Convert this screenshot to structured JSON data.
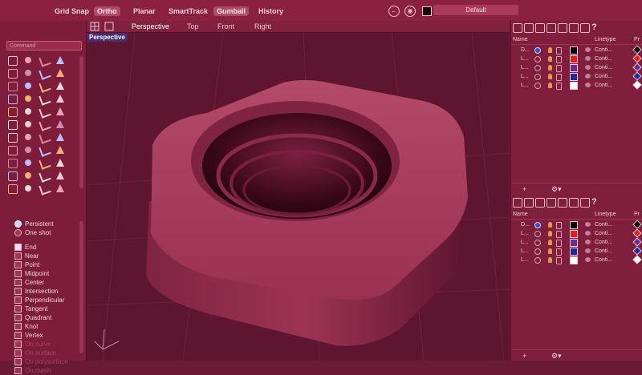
{
  "topbar": {
    "toggles": [
      {
        "label": "Grid Snap",
        "on": false
      },
      {
        "label": "Ortho",
        "on": true
      },
      {
        "label": "Planar",
        "on": false
      },
      {
        "label": "SmartTrack",
        "on": false
      },
      {
        "label": "Gumball",
        "on": true
      },
      {
        "label": "History",
        "on": false
      }
    ],
    "layer_name": "Default"
  },
  "left": {
    "command_placeholder": "Command",
    "osnap_mode": [
      {
        "label": "Persistent",
        "selected": true
      },
      {
        "label": "One shot",
        "selected": false
      }
    ],
    "osnaps": [
      {
        "label": "End",
        "checked": true,
        "dim": false
      },
      {
        "label": "Near",
        "checked": false,
        "dim": false
      },
      {
        "label": "Point",
        "checked": false,
        "dim": false
      },
      {
        "label": "Midpoint",
        "checked": false,
        "dim": false
      },
      {
        "label": "Center",
        "checked": false,
        "dim": false
      },
      {
        "label": "Intersection",
        "checked": false,
        "dim": false
      },
      {
        "label": "Perpendicular",
        "checked": false,
        "dim": false
      },
      {
        "label": "Tangent",
        "checked": false,
        "dim": false
      },
      {
        "label": "Quadrant",
        "checked": false,
        "dim": false
      },
      {
        "label": "Knot",
        "checked": false,
        "dim": false
      },
      {
        "label": "Vertex",
        "checked": false,
        "dim": false
      },
      {
        "label": "On curve",
        "checked": false,
        "dim": true
      },
      {
        "label": "On surface",
        "checked": false,
        "dim": true
      },
      {
        "label": "On polysurface",
        "checked": false,
        "dim": true
      },
      {
        "label": "On mesh",
        "checked": false,
        "dim": true
      }
    ]
  },
  "viewport": {
    "tabs": [
      "Perspective",
      "Top",
      "Front",
      "Right"
    ],
    "active_tab": "Perspective",
    "label": "Perspective"
  },
  "layers": {
    "headers": {
      "name": "Name",
      "linetype": "Linetype",
      "print": "Pr"
    },
    "panels": [
      {
        "rows": [
          {
            "name": "D...",
            "current": true,
            "color": "#000000",
            "linetype": "Conti...",
            "pcolor": "#000000"
          },
          {
            "name": "L...",
            "current": false,
            "color": "#e02020",
            "linetype": "Conti...",
            "pcolor": "#e02020"
          },
          {
            "name": "L...",
            "current": false,
            "color": "#6a2c8c",
            "linetype": "Conti...",
            "pcolor": "#6a2c8c"
          },
          {
            "name": "L...",
            "current": false,
            "color": "#1c2a9c",
            "linetype": "Conti...",
            "pcolor": "#1c2a9c"
          },
          {
            "name": "L...",
            "current": false,
            "color": "#ffffff",
            "linetype": "Conti...",
            "pcolor": "#ffffff"
          }
        ],
        "add_label": "+"
      },
      {
        "rows": [
          {
            "name": "D...",
            "current": true,
            "color": "#000000",
            "linetype": "Conti...",
            "pcolor": "#000000"
          },
          {
            "name": "L...",
            "current": false,
            "color": "#e02020",
            "linetype": "Conti...",
            "pcolor": "#e02020"
          },
          {
            "name": "L...",
            "current": false,
            "color": "#6a2c8c",
            "linetype": "Conti...",
            "pcolor": "#6a2c8c"
          },
          {
            "name": "L...",
            "current": false,
            "color": "#1c2a9c",
            "linetype": "Conti...",
            "pcolor": "#1c2a9c"
          },
          {
            "name": "L...",
            "current": false,
            "color": "#ffffff",
            "linetype": "Conti...",
            "pcolor": "#ffffff"
          }
        ],
        "add_label": "+"
      }
    ]
  },
  "colors": {
    "overlay": "#8a1e42",
    "current_dot": "#3550c0",
    "bulb": "#e39a3a"
  }
}
